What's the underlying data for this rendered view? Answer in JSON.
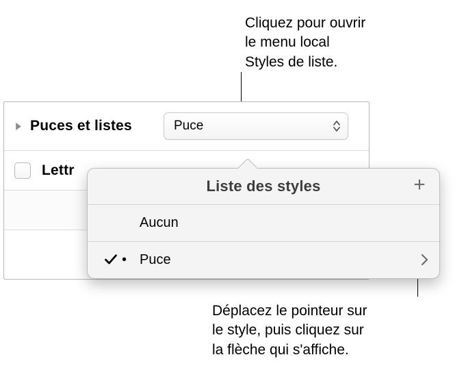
{
  "callouts": {
    "top": "Cliquez pour ouvrir\nle menu local\nStyles de liste.",
    "bottom": "Déplacez le pointeur sur\nle style, puis cliquez sur\nla flèche qui s'affiche."
  },
  "panel": {
    "bullets_label": "Puces et listes",
    "select_value": "Puce",
    "lettrine_label": "Lettr"
  },
  "popover": {
    "title": "Liste des styles",
    "items": [
      {
        "label": "Aucun",
        "selected": false,
        "bullet": ""
      },
      {
        "label": "Puce",
        "selected": true,
        "bullet": "•"
      }
    ]
  },
  "icons": {
    "disclosure": "chevron-right",
    "select_arrows": "stepper-arrows",
    "add": "+",
    "check": "checkmark",
    "chev_right": "chevron-right"
  }
}
